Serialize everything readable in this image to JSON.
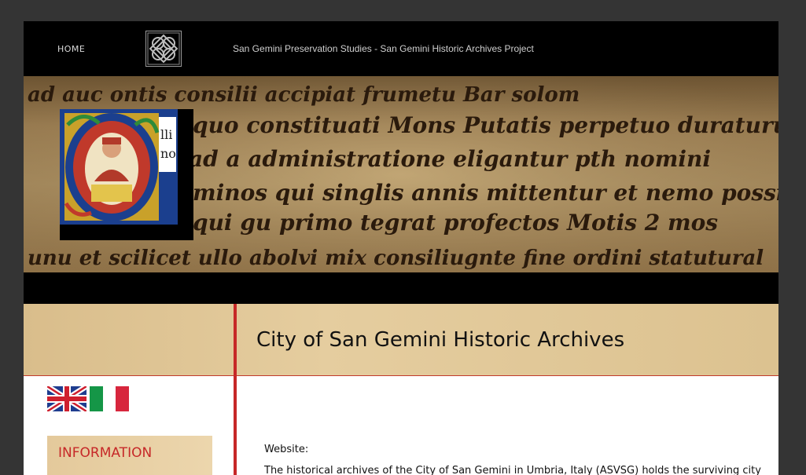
{
  "nav": {
    "home_label": "HOME",
    "site_title": "San Gemini Preservation Studies - San Gemini Historic Archives Project"
  },
  "banner": {
    "manuscript_lines": [
      "ad auc ontis consilii accipiat frumetu Bar solom",
      "quo constituati Mons Putatis perpetuo duraturus",
      "ad a administratione eligantur pth nomini",
      "minos qui singlis annis mittentur et nemo possit",
      "qui gu primo tegrat profectos Motis 2 mos",
      "unu et scilicet ullo abolvi mix consiliugnte fine ordini statutural"
    ]
  },
  "main": {
    "title": "City of San Gemini Historic Archives",
    "website_label": "Website:",
    "intro_text": "The historical archives of the City of San Gemini in Umbria, Italy (ASVSG) holds the surviving city"
  },
  "sidebar": {
    "languages": [
      "English",
      "Italiano"
    ],
    "info_label": "INFORMATION"
  },
  "colors": {
    "accent_red": "#c62828",
    "parchment": "#e5cd9f",
    "frame_bg": "#343434"
  }
}
